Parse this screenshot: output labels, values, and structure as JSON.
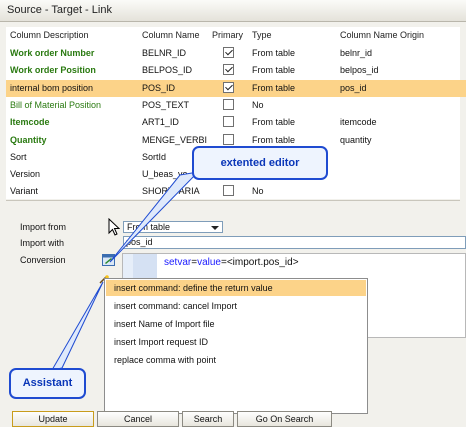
{
  "window": {
    "title": "Source - Target - Link"
  },
  "table": {
    "headers": [
      "Column Description",
      "Column Name",
      "Primary",
      "Type",
      "Column Name Origin"
    ],
    "rows": [
      {
        "description": "Work order Number",
        "column_name": "BELNR_ID",
        "primary": true,
        "type": "From table",
        "origin": "belnr_id",
        "style": "green-bold"
      },
      {
        "description": "Work order Position",
        "column_name": "BELPOS_ID",
        "primary": true,
        "type": "From table",
        "origin": "belpos_id",
        "style": "green-bold"
      },
      {
        "description": "internal bom position",
        "column_name": "POS_ID",
        "primary": true,
        "type": "From table",
        "origin": "pos_id",
        "style": "selected"
      },
      {
        "description": "Bill of Material Position",
        "column_name": "POS_TEXT",
        "primary": false,
        "type": "No",
        "origin": "",
        "style": "green"
      },
      {
        "description": "Itemcode",
        "column_name": "ART1_ID",
        "primary": false,
        "type": "From table",
        "origin": "itemcode",
        "style": "green-bold"
      },
      {
        "description": "Quantity",
        "column_name": "MENGE_VERBI",
        "primary": false,
        "type": "From table",
        "origin": "quantity",
        "style": "green-bold"
      },
      {
        "description": "Sort",
        "column_name": "SortId",
        "primary": false,
        "type": "",
        "origin": "",
        "style": "plain"
      },
      {
        "description": "Version",
        "column_name": "U_beas_ve",
        "primary": false,
        "type": "",
        "origin": "",
        "style": "plain"
      },
      {
        "description": "Variant",
        "column_name": "SHORTVARIA",
        "primary": false,
        "type": "No",
        "origin": "",
        "style": "plain"
      }
    ]
  },
  "form": {
    "import_from_label": "Import from",
    "import_from_value": "From table",
    "import_with_label": "Import with",
    "import_with_value": "pos_id",
    "conversion_label": "Conversion",
    "code": {
      "keyword1": "setvar",
      "op1": "=",
      "keyword2": "value",
      "op2": "=",
      "text": "<import.pos_id>"
    }
  },
  "assistant_menu": {
    "items": [
      "insert command: define the return value",
      "insert command: cancel Import",
      "insert Name of Import file",
      "insert Import request ID",
      "replace comma with point"
    ],
    "highlighted_index": 0
  },
  "callouts": {
    "editor": "extented editor",
    "assistant": "Assistant"
  },
  "buttons": {
    "update": "Update",
    "cancel": "Cancel",
    "search": "Search",
    "go_on_search": "Go On Search"
  },
  "colors": {
    "green_text": "#2a7a11",
    "selection": "#fcd389",
    "callout_border": "#1f4bd1",
    "keyword": "#1a1aff"
  },
  "icons": {
    "editor": "edit-window-icon",
    "assistant": "wand-icon",
    "cursor": "mouse-pointer-icon"
  }
}
